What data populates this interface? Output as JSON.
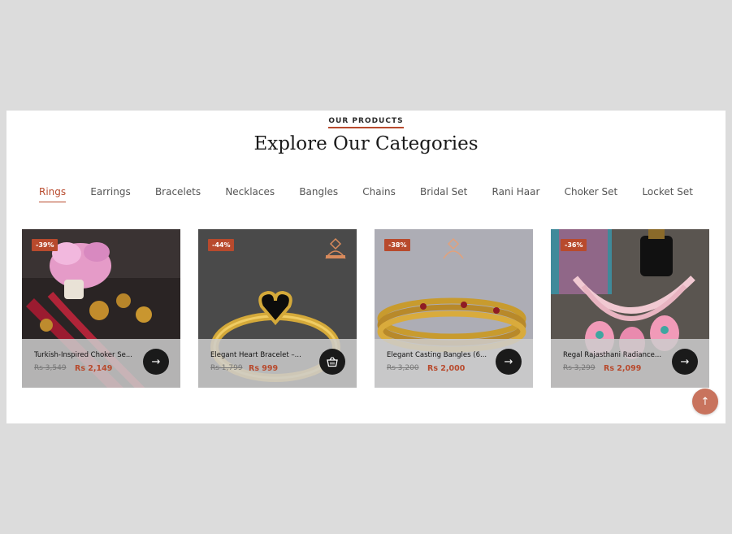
{
  "section": {
    "eyebrow": "OUR PRODUCTS",
    "title": "Explore Our Categories"
  },
  "tabs": [
    {
      "label": "Rings",
      "active": true
    },
    {
      "label": "Earrings",
      "active": false
    },
    {
      "label": "Bracelets",
      "active": false
    },
    {
      "label": "Necklaces",
      "active": false
    },
    {
      "label": "Bangles",
      "active": false
    },
    {
      "label": "Chains",
      "active": false
    },
    {
      "label": "Bridal Set",
      "active": false
    },
    {
      "label": "Rani Haar",
      "active": false
    },
    {
      "label": "Choker Set",
      "active": false
    },
    {
      "label": "Locket Set",
      "active": false
    }
  ],
  "products": [
    {
      "badge": "-39%",
      "name": "Turkish-Inspired Choker Se...",
      "old_price": "Rs 3,549",
      "new_price": "Rs 2,149",
      "action_icon": "arrow-right-icon"
    },
    {
      "badge": "-44%",
      "name": "Elegant Heart Bracelet –...",
      "old_price": "Rs 1,799",
      "new_price": "Rs 999",
      "action_icon": "basket-icon"
    },
    {
      "badge": "-38%",
      "name": "Elegant Casting Bangles (6...",
      "old_price": "Rs 3,200",
      "new_price": "Rs 2,000",
      "action_icon": "arrow-right-icon"
    },
    {
      "badge": "-36%",
      "name": "Regal Rajasthani Radiance...",
      "old_price": "Rs 3,299",
      "new_price": "Rs 2,099",
      "action_icon": "arrow-right-icon"
    }
  ],
  "colors": {
    "accent": "#b84a2d",
    "page_background": "#dcdcdc"
  },
  "scroll_top_icon": "arrow-up-icon"
}
